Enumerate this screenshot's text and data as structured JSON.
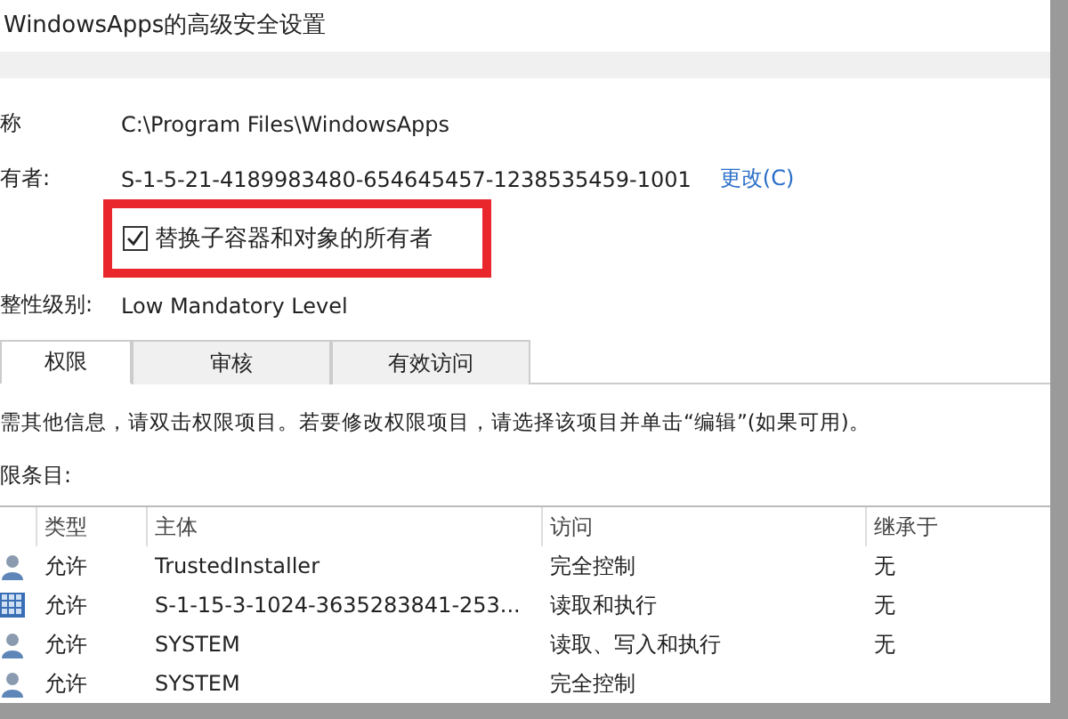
{
  "window": {
    "title": "WindowsApps的高级安全设置"
  },
  "fields": [
    {
      "label": "称",
      "value": "C:\\Program Files\\WindowsApps"
    },
    {
      "label": "有者:",
      "value": "S-1-5-21-4189983480-654645457-1238535459-1001",
      "link": "更改(C)"
    }
  ],
  "replace_owner": {
    "label": "替换子容器和对象的所有者",
    "checked": true
  },
  "integrity": {
    "label": "整性级别:",
    "value": "Low Mandatory Level"
  },
  "tabs": [
    {
      "label": "权限",
      "selected": true
    },
    {
      "label": "审核",
      "selected": false
    },
    {
      "label": "有效访问",
      "selected": false
    }
  ],
  "info": "需其他信息，请双击权限项目。若要修改权限项目，请选择该项目并单击“编辑”(如果可用)。",
  "entries_label": "限条目:",
  "table": {
    "columns": [
      "类型",
      "主体",
      "访问",
      "继承于"
    ],
    "rows": [
      {
        "kind": "user",
        "type": "允许",
        "principal": "TrustedInstaller",
        "access": "完全控制",
        "inherited": "无"
      },
      {
        "kind": "app",
        "type": "允许",
        "principal": "S-1-15-3-1024-3635283841-253...",
        "access": "读取和执行",
        "inherited": "无"
      },
      {
        "kind": "user",
        "type": "允许",
        "principal": "SYSTEM",
        "access": "读取、写入和执行",
        "inherited": "无"
      },
      {
        "kind": "user",
        "type": "允许",
        "principal": "SYSTEM",
        "access": "完全控制"
      }
    ]
  }
}
